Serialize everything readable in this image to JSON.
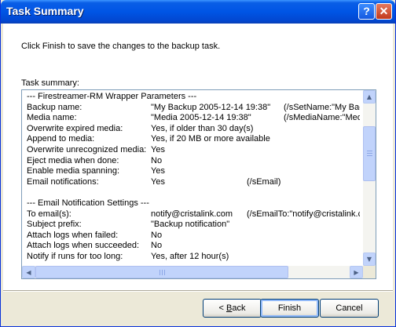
{
  "window": {
    "title": "Task Summary",
    "help_glyph": "?",
    "close_glyph": "✕"
  },
  "instruction": "Click Finish to save the changes to the backup task.",
  "summary_label": "Task summary:",
  "summary": {
    "lines": [
      {
        "c1": "--- Firestreamer-RM Wrapper Parameters ---",
        "c2": "",
        "c3": ""
      },
      {
        "c1": "Backup name:",
        "c2": "\"My Backup 2005-12-14 19:38\"",
        "c3": "(/sSetName:\"My Bac"
      },
      {
        "c1": "Media name:",
        "c2": "\"Media 2005-12-14 19:38\"",
        "c3": "(/sMediaName:\"Medi"
      },
      {
        "c1": "Overwrite expired media:",
        "c2": "Yes, if older than 30 day(s)",
        "c3": ""
      },
      {
        "c1": "Append to media:",
        "c2": "Yes, if 20 MB or more available",
        "c3": ""
      },
      {
        "c1": "Overwrite unrecognized media:",
        "c2": "Yes",
        "c3": ""
      },
      {
        "c1": "Eject media when done:",
        "c2": "No",
        "c3": ""
      },
      {
        "c1": "Enable media spanning:",
        "c2": "Yes",
        "c3": ""
      },
      {
        "c1": "Email notifications:",
        "c2": "Yes",
        "c3": "(/sEmail)"
      },
      {
        "c1": "",
        "c2": "",
        "c3": ""
      },
      {
        "c1": "--- Email Notification Settings ---",
        "c2": "",
        "c3": ""
      },
      {
        "c1": "To email(s):",
        "c2": "notify@cristalink.com",
        "c3": "(/sEmailTo:\"notify@cristalink.co"
      },
      {
        "c1": "Subject prefix:",
        "c2": "\"Backup notification\"",
        "c3": ""
      },
      {
        "c1": "Attach logs when failed:",
        "c2": "No",
        "c3": ""
      },
      {
        "c1": "Attach logs when succeeded:",
        "c2": "No",
        "c3": ""
      },
      {
        "c1": "Notify if runs for too long:",
        "c2": "Yes, after 12 hour(s)",
        "c3": ""
      }
    ],
    "vscroll_thumb_fraction": 0.3,
    "hscroll_thumb_fraction": 0.8
  },
  "buttons": {
    "back_prefix": "< ",
    "back_accel": "B",
    "back_rest": "ack",
    "finish": "Finish",
    "cancel": "Cancel"
  }
}
